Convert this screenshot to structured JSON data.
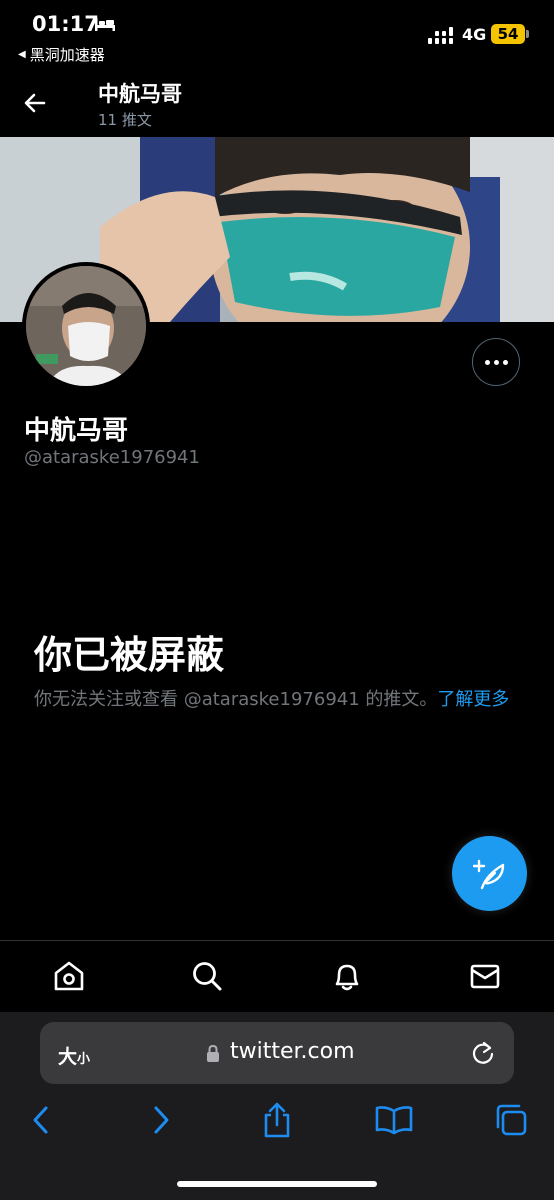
{
  "status_bar": {
    "time": "01:17",
    "back_app": "黑洞加速器",
    "network": "4G",
    "battery": "54"
  },
  "header": {
    "title": "中航马哥",
    "tweet_count": "11 推文"
  },
  "profile": {
    "name": "中航马哥",
    "handle": "@ataraske1976941"
  },
  "blocked": {
    "title": "你已被屏蔽",
    "message": "你无法关注或查看 @ataraske1976941 的推文。",
    "link": "了解更多"
  },
  "tabs": [
    "home-icon",
    "search-icon",
    "notifications-icon",
    "messages-icon"
  ],
  "safari": {
    "text_size": "大",
    "text_size_small": "小",
    "url": "twitter.com"
  },
  "colors": {
    "accent": "#1d9bf0",
    "battery": "#f5c400"
  }
}
